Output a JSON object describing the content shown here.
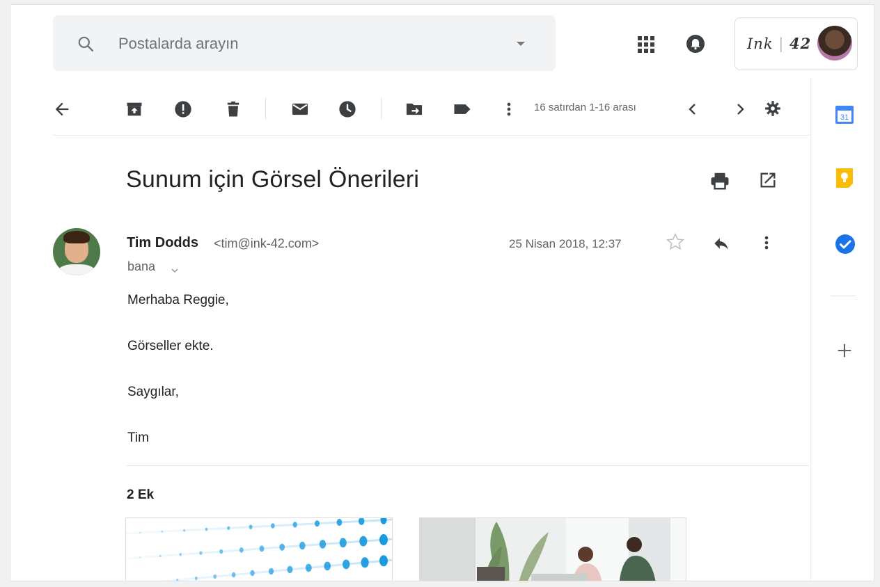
{
  "search": {
    "placeholder": "Postalarda arayın"
  },
  "header": {
    "apps_icon": "apps-grid-icon",
    "notifications_icon": "notifications-icon",
    "brand_name_main": "Ink",
    "brand_name_num": "42"
  },
  "toolbar": {
    "paging_text": "16 satırdan 1-16 arası",
    "icons": [
      "back-arrow-icon",
      "archive-icon",
      "report-spam-icon",
      "delete-icon",
      "mark-unread-icon",
      "snooze-icon",
      "move-to-icon",
      "label-icon",
      "more-vert-icon",
      "prev-icon",
      "next-icon",
      "settings-icon"
    ]
  },
  "message": {
    "subject": "Sunum için Görsel Önerileri",
    "sender_name": "Tim Dodds",
    "sender_email": "<tim@ink-42.com>",
    "to": "bana",
    "date": "25 Nisan 2018, 12:37",
    "body": [
      "Merhaba Reggie,",
      "Görseller ekte.",
      "Saygılar,",
      "Tim"
    ],
    "attachments_label": "2 Ek"
  },
  "rail": {
    "calendar_day": "31",
    "items": [
      "calendar-icon",
      "keep-icon",
      "tasks-icon",
      "add-icon"
    ]
  },
  "colors": {
    "calendar_blue": "#4285f4",
    "keep_yellow": "#fbbc04",
    "tasks_blue": "#1a73e8",
    "icon_gray": "#5f6368",
    "dot_blue": "#1a9ae0"
  }
}
